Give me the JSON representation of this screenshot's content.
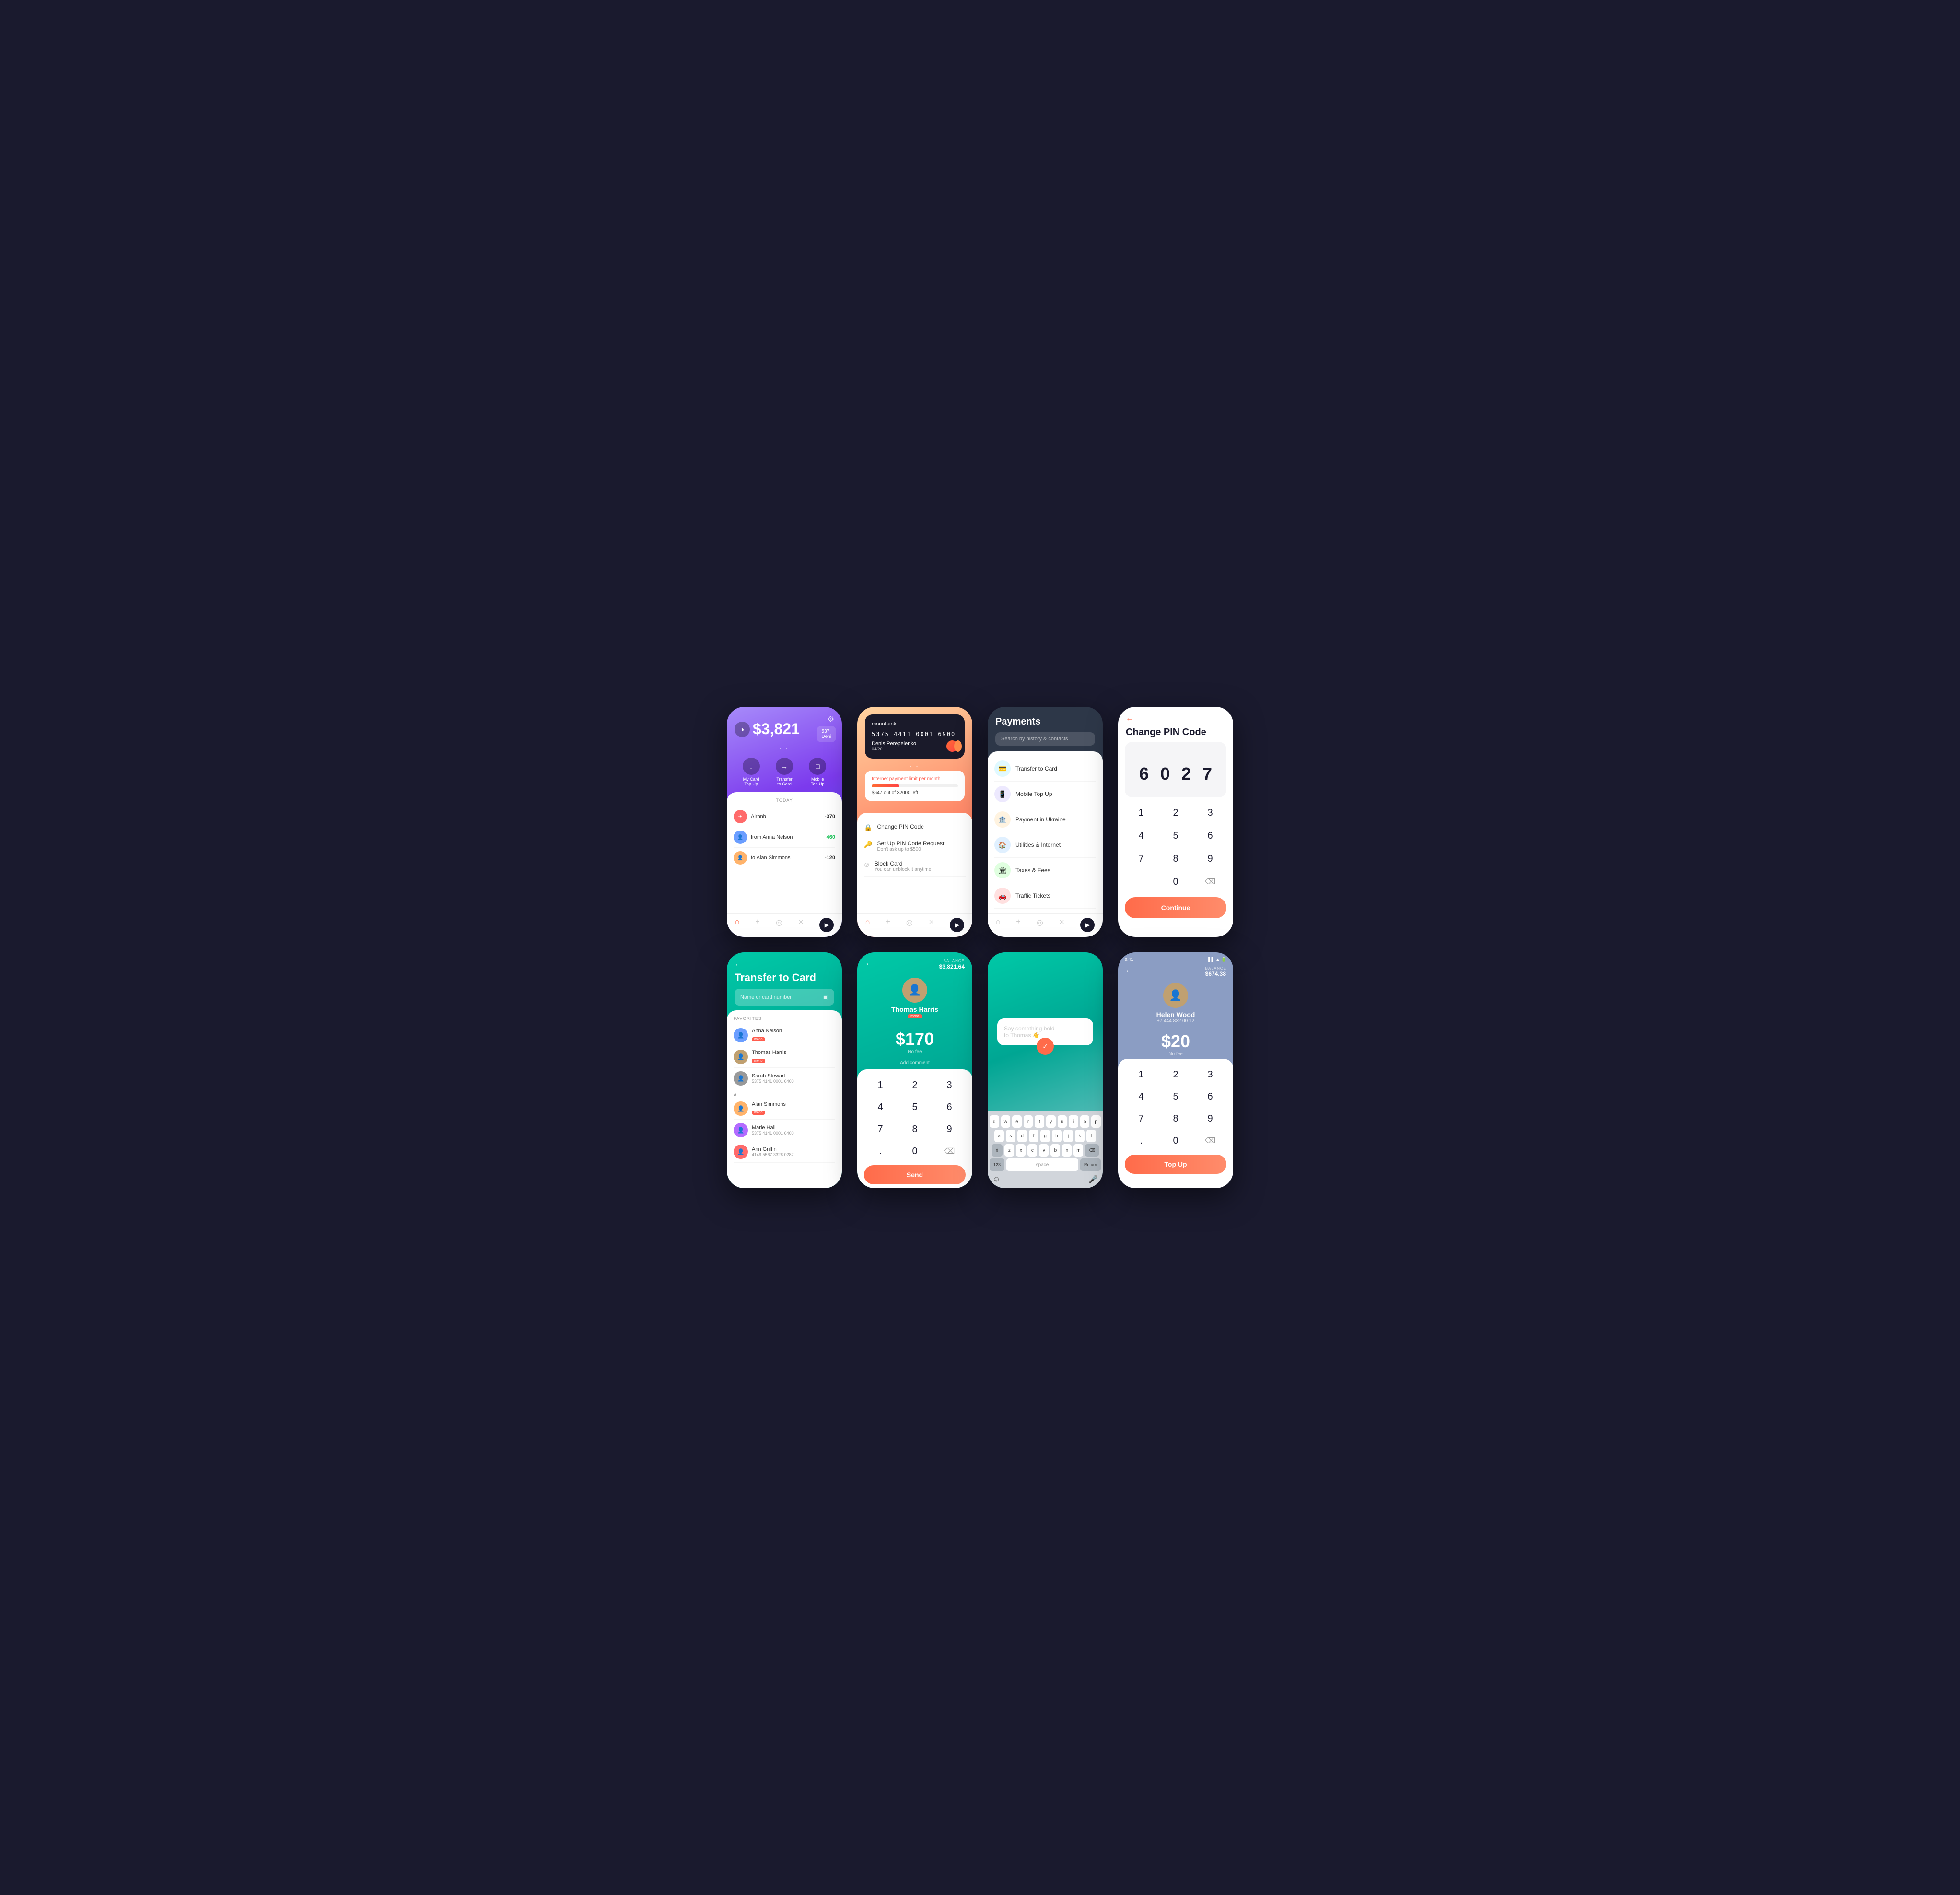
{
  "phones": {
    "phone1": {
      "balance": "$3,821",
      "card_last": "537",
      "card_owner": "Deni",
      "gear_icon": "⚙",
      "actions": [
        {
          "icon": "↓",
          "label": "My Card\nTop Up"
        },
        {
          "icon": "→",
          "label": "Transfer\nto Card"
        },
        {
          "icon": "□",
          "label": "Mobile\nTop Up"
        }
      ],
      "today_label": "TODAY",
      "transactions": [
        {
          "name": "Airbnb",
          "amount": "-370",
          "type": "neg",
          "icon": "✈"
        },
        {
          "name": "from Anna Nelson",
          "amount": "460",
          "type": "pos"
        },
        {
          "name": "to Alan Simmons",
          "amount": "-120",
          "type": "neg"
        }
      ]
    },
    "phone2": {
      "bank_name": "monobank",
      "card_number": "5375 4411 0001 6900",
      "card_date": "04/20",
      "card_holder": "Denis Perepelenko",
      "limit_title": "Internet payment limit per month",
      "limit_text": "$647 out of $2000 left",
      "menu_items": [
        {
          "icon": "🔒",
          "title": "Change PIN Code",
          "sub": ""
        },
        {
          "icon": "🔑",
          "title": "Set Up PIN Code Request",
          "sub": "Don't ask up to $500"
        },
        {
          "icon": "⊘",
          "title": "Block Card",
          "sub": "You can unblock it anytime"
        }
      ]
    },
    "phone3": {
      "title": "Payments",
      "search_placeholder": "Search by history & contacts",
      "payment_items": [
        {
          "icon": "💳",
          "name": "Transfer to Card",
          "color": "#22d3ee"
        },
        {
          "icon": "📱",
          "name": "Mobile Top Up",
          "color": "#6366f1"
        },
        {
          "icon": "🏦",
          "name": "Payment in Ukraine",
          "color": "#f97316"
        },
        {
          "icon": "🏠",
          "name": "Utilities & Internet",
          "color": "#3b82f6"
        },
        {
          "icon": "🏛",
          "name": "Taxes & Fees",
          "color": "#22c55e"
        },
        {
          "icon": "🚗",
          "name": "Traffic Tickets",
          "color": "#ef4444"
        }
      ]
    },
    "phone4": {
      "title": "Change PIN Code",
      "back_icon": "←",
      "pin_digits": [
        "6",
        "0",
        "2",
        "7"
      ],
      "numpad": [
        "1",
        "2",
        "3",
        "4",
        "5",
        "6",
        "7",
        "8",
        "9",
        "",
        "0",
        "⌫"
      ],
      "continue_btn": "Continue"
    },
    "phone5": {
      "back_icon": "←",
      "title": "Transfer to Card",
      "input_placeholder": "Name or card number",
      "scan_icon": "▣",
      "favorites_label": "FAVORITES",
      "contacts": [
        {
          "name": "Anna Nelson",
          "badge": "mono",
          "sub": ""
        },
        {
          "name": "Thomas Harris",
          "badge": "mono",
          "sub": ""
        },
        {
          "name": "Sarah Stewart",
          "badge": "",
          "sub": "5375 4141 0001 6400"
        },
        {
          "section": "A"
        },
        {
          "name": "Alan Simmons",
          "badge": "mono",
          "sub": ""
        },
        {
          "name": "Marie Hall",
          "badge": "",
          "sub": "5375 4141 0001 6400"
        },
        {
          "name": "Ann Griffin",
          "badge": "",
          "sub": "4149 5567 3328 0287"
        }
      ]
    },
    "phone6": {
      "back_icon": "←",
      "balance_label": "BALANCE",
      "balance_value": "$3,821.64",
      "recipient_name": "Thomas Harris",
      "recipient_badge": "mono",
      "amount": "$170",
      "fee": "No fee",
      "add_comment": "Add comment",
      "numpad": [
        "1",
        "2",
        "3",
        "4",
        "5",
        "6",
        "7",
        "8",
        "9",
        ".",
        "0",
        "⌫"
      ],
      "send_btn": "Send"
    },
    "phone7": {
      "message_placeholder": "Say something bold\nto Thomas 👋",
      "send_icon": "✓",
      "keyboard_rows": [
        [
          "q",
          "w",
          "e",
          "r",
          "t",
          "y",
          "u",
          "i",
          "o",
          "p"
        ],
        [
          "a",
          "s",
          "d",
          "f",
          "g",
          "h",
          "j",
          "k",
          "l"
        ],
        [
          "z",
          "x",
          "c",
          "v",
          "b",
          "n",
          "m"
        ]
      ],
      "kb_nums": "123",
      "kb_space": "space",
      "kb_return": "Return"
    },
    "phone8": {
      "status_time": "9:41",
      "back_icon": "←",
      "balance_label": "BALANCE",
      "balance_value": "$674.38",
      "recipient_name": "Helen Wood",
      "recipient_phone": "+7 444 832 00 12",
      "amount": "$20",
      "fee": "No fee",
      "numpad": [
        "1",
        "2",
        "3",
        "4",
        "5",
        "6",
        "7",
        "8",
        "9",
        ".",
        "0",
        "⌫"
      ],
      "topup_btn": "Top Up"
    }
  }
}
